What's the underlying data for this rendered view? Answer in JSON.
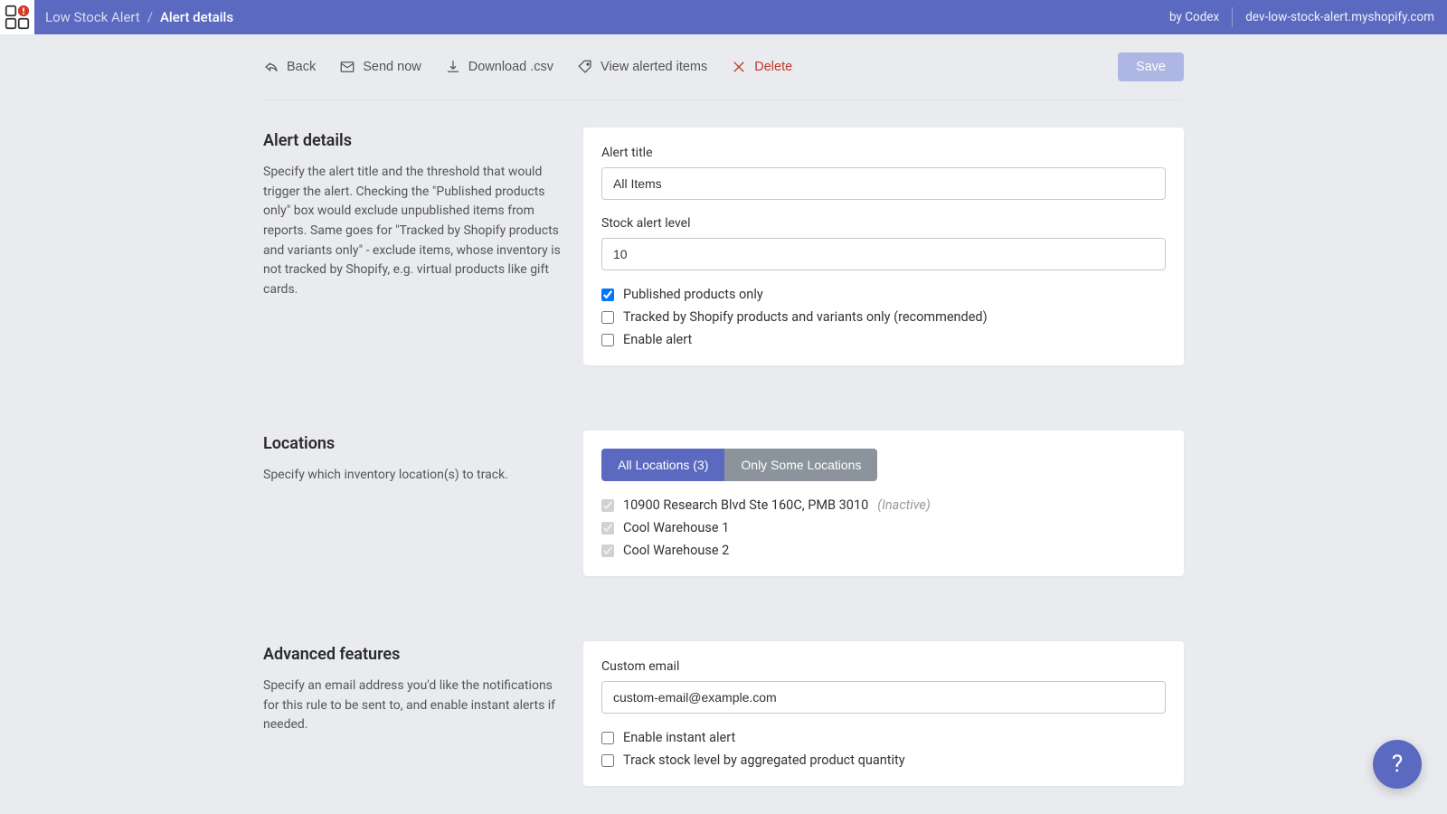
{
  "header": {
    "breadcrumb_root": "Low Stock Alert",
    "breadcrumb_current": "Alert details",
    "by_label": "by Codex",
    "shop_domain": "dev-low-stock-alert.myshopify.com"
  },
  "toolbar": {
    "back": "Back",
    "send_now": "Send now",
    "download_csv": "Download .csv",
    "view_alerted": "View alerted items",
    "delete": "Delete",
    "save": "Save"
  },
  "sections": {
    "details": {
      "title": "Alert details",
      "desc": "Specify the alert title and the threshold that would trigger the alert. Checking the \"Published products only\" box would exclude unpublished items from reports. Same goes for \"Tracked by Shopify products and variants only\" - exclude items, whose inventory is not tracked by Shopify, e.g. virtual products like gift cards.",
      "alert_title_label": "Alert title",
      "alert_title_value": "All Items",
      "stock_level_label": "Stock alert level",
      "stock_level_value": "10",
      "published_only_label": "Published products only",
      "tracked_only_label": "Tracked by Shopify products and variants only (recommended)",
      "enable_alert_label": "Enable alert"
    },
    "locations": {
      "title": "Locations",
      "desc": "Specify which inventory location(s) to track.",
      "tab_all": "All Locations (3)",
      "tab_some": "Only Some Locations",
      "items": [
        {
          "label": "10900 Research Blvd Ste 160C, PMB 3010",
          "inactive_suffix": "(Inactive)"
        },
        {
          "label": "Cool Warehouse 1",
          "inactive_suffix": ""
        },
        {
          "label": "Cool Warehouse 2",
          "inactive_suffix": ""
        }
      ]
    },
    "advanced": {
      "title": "Advanced features",
      "desc": "Specify an email address you'd like the notifications for this rule to be sent to, and enable instant alerts if needed.",
      "custom_email_label": "Custom email",
      "custom_email_value": "custom-email@example.com",
      "enable_instant_label": "Enable instant alert",
      "track_aggregate_label": "Track stock level by aggregated product quantity"
    }
  },
  "help": {
    "glyph": "?"
  }
}
